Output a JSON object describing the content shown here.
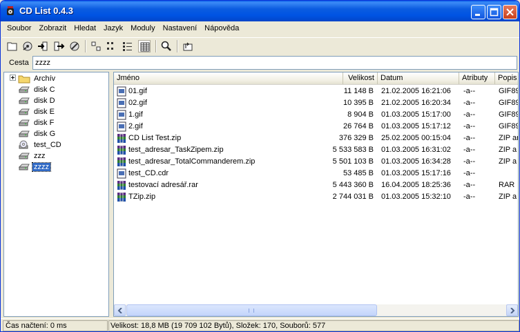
{
  "window": {
    "title": "CD List  0.4.3"
  },
  "menu": [
    "Soubor",
    "Zobrazit",
    "Hledat",
    "Jazyk",
    "Moduly",
    "Nastavení",
    "Nápověda"
  ],
  "path": {
    "label": "Cesta",
    "value": "zzzz"
  },
  "tree": [
    {
      "label": "Archív",
      "icon": "folder-icon"
    },
    {
      "label": "disk C",
      "icon": "drive-icon"
    },
    {
      "label": "disk D",
      "icon": "drive-icon"
    },
    {
      "label": "disk E",
      "icon": "drive-icon"
    },
    {
      "label": "disk F",
      "icon": "drive-icon"
    },
    {
      "label": "disk G",
      "icon": "drive-icon"
    },
    {
      "label": "test_CD",
      "icon": "cd-drive-icon"
    },
    {
      "label": "zzz",
      "icon": "drive-icon"
    },
    {
      "label": "zzzz",
      "icon": "drive-icon",
      "selected": true
    }
  ],
  "columns": [
    "Jméno",
    "Velikost",
    "Datum",
    "Atributy",
    "Popis"
  ],
  "files": [
    {
      "name": "01.gif",
      "size": "11 148  B",
      "date": "21.02.2005 16:21:06",
      "attr": "-a--",
      "desc": "GIF89",
      "icon": "image-file-icon"
    },
    {
      "name": "02.gif",
      "size": "10 395  B",
      "date": "21.02.2005 16:20:34",
      "attr": "-a--",
      "desc": "GIF89",
      "icon": "image-file-icon"
    },
    {
      "name": "1.gif",
      "size": "8 904  B",
      "date": "01.03.2005 15:17:00",
      "attr": "-a--",
      "desc": "GIF89",
      "icon": "image-file-icon"
    },
    {
      "name": "2.gif",
      "size": "26 764  B",
      "date": "01.03.2005 15:17:12",
      "attr": "-a--",
      "desc": "GIF89",
      "icon": "image-file-icon"
    },
    {
      "name": "CD List Test.zip",
      "size": "376 329  B",
      "date": "25.02.2005 00:15:04",
      "attr": "-a--",
      "desc": "ZIP ar",
      "icon": "archive-file-icon"
    },
    {
      "name": "test_adresar_TaskZipem.zip",
      "size": "5 533 583  B",
      "date": "01.03.2005 16:31:02",
      "attr": "-a--",
      "desc": "ZIP a",
      "icon": "archive-file-icon"
    },
    {
      "name": "test_adresar_TotalCommanderem.zip",
      "size": "5 501 103  B",
      "date": "01.03.2005 16:34:28",
      "attr": "-a--",
      "desc": "ZIP a",
      "icon": "archive-file-icon"
    },
    {
      "name": "test_CD.cdr",
      "size": "53 485  B",
      "date": "01.03.2005 15:17:16",
      "attr": "-a--",
      "desc": "",
      "icon": "image-file-icon"
    },
    {
      "name": "testovací adresář.rar",
      "size": "5 443 360  B",
      "date": "16.04.2005 18:25:36",
      "attr": "-a--",
      "desc": "RAR",
      "icon": "archive-file-icon"
    },
    {
      "name": "TZip.zip",
      "size": "2 744 031  B",
      "date": "01.03.2005 15:32:10",
      "attr": "-a--",
      "desc": "ZIP a",
      "icon": "archive-file-icon"
    }
  ],
  "status": {
    "load_time": "Čas načtení: 0 ms",
    "summary": "Velikost: 18,8 MB (19 709 102  Bytů), Složek: 170, Souborů: 577"
  },
  "colors": {
    "title_bar": "#0054e3",
    "selection": "#316ac5"
  }
}
